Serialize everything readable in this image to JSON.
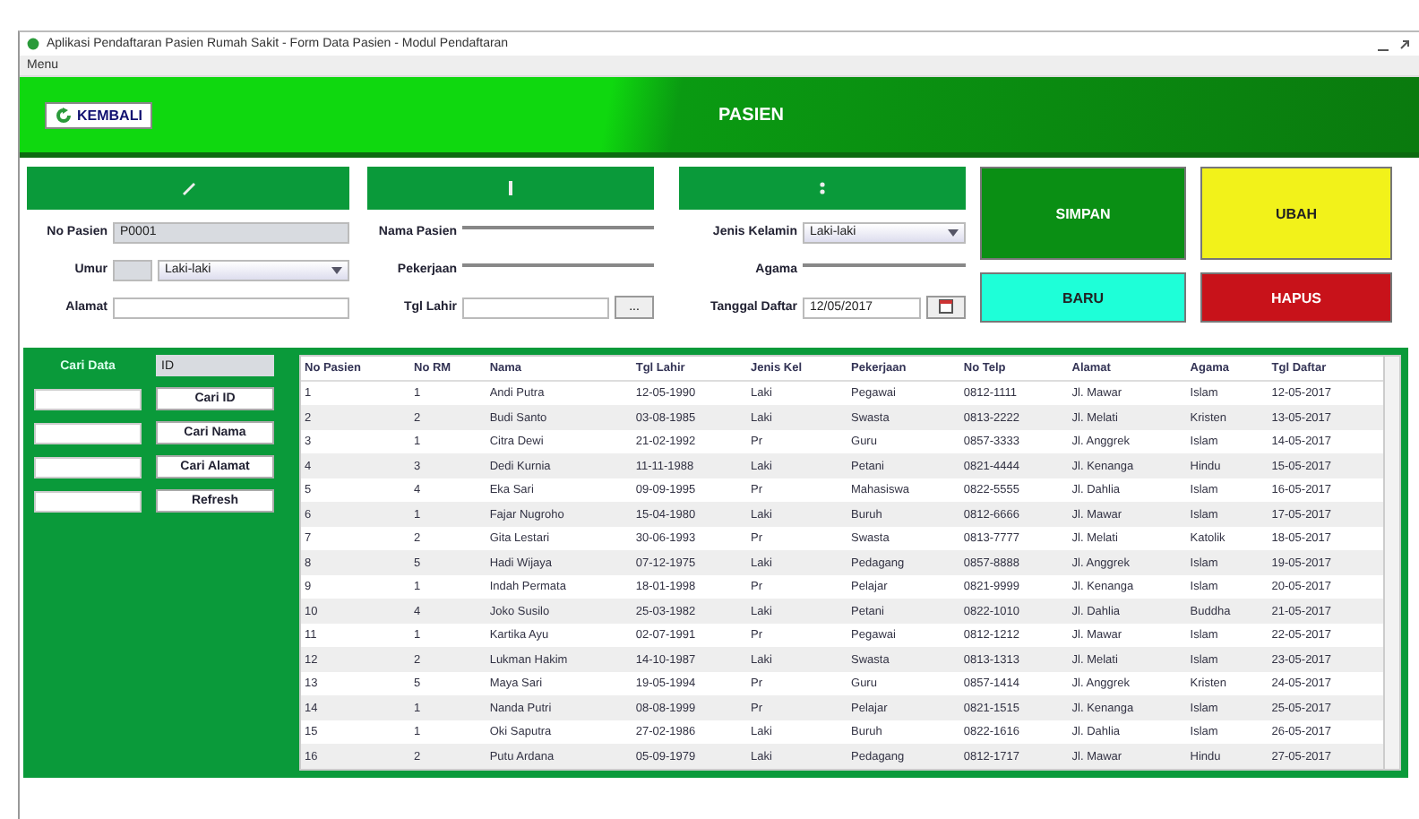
{
  "window": {
    "title": "Aplikasi Pendaftaran Pasien Rumah Sakit - Form Data Pasien - Modul Pendaftaran"
  },
  "menu": [
    "Menu"
  ],
  "header": {
    "back_button": "KEMBALI",
    "title": "PASIEN"
  },
  "sections": [
    {
      "fields": [
        {
          "kind": "readonly",
          "label": "No Pasien",
          "value": "P0001"
        },
        {
          "kind": "age-select",
          "label": "Umur",
          "value": "Laki-laki"
        },
        {
          "kind": "text",
          "label": "Alamat"
        }
      ]
    },
    {
      "fields": [
        {
          "kind": "line",
          "label": "Nama Pasien"
        },
        {
          "kind": "line",
          "label": "Pekerjaan"
        },
        {
          "kind": "picker",
          "label": "Tgl Lahir",
          "button": "..."
        }
      ]
    },
    {
      "fields": [
        {
          "kind": "select",
          "label": "Jenis Kelamin",
          "value": "Laki-laki"
        },
        {
          "kind": "line",
          "label": "Agama"
        },
        {
          "kind": "date",
          "label": "Tanggal Daftar",
          "value": "12/05/2017"
        }
      ]
    }
  ],
  "actions": [
    {
      "label": "SIMPAN",
      "color": "#0a8f14"
    },
    {
      "label": "UBAH",
      "color": "#f2f21a"
    },
    {
      "label": "BARU",
      "color": "#1effd8"
    },
    {
      "label": "HAPUS",
      "color": "#c8121a"
    }
  ],
  "search": {
    "label": "Cari Data",
    "value": "ID",
    "buttons": [
      "Cari ID",
      "Cari Nama",
      "Cari Alamat",
      "Refresh"
    ]
  },
  "table": {
    "columns": [
      "No Pasien",
      "No RM",
      "Nama",
      "Tgl Lahir",
      "Jenis Kel",
      "Pekerjaan",
      "No Telp",
      "Alamat",
      "Agama",
      "Tgl Daftar"
    ],
    "rows": [
      [
        "1",
        "1",
        "Andi Putra",
        "12-05-1990",
        "Laki",
        "Pegawai",
        "0812-1111",
        "Jl. Mawar",
        "Islam",
        "12-05-2017"
      ],
      [
        "2",
        "2",
        "Budi Santo",
        "03-08-1985",
        "Laki",
        "Swasta",
        "0813-2222",
        "Jl. Melati",
        "Kristen",
        "13-05-2017"
      ],
      [
        "3",
        "1",
        "Citra Dewi",
        "21-02-1992",
        "Pr",
        "Guru",
        "0857-3333",
        "Jl. Anggrek",
        "Islam",
        "14-05-2017"
      ],
      [
        "4",
        "3",
        "Dedi Kurnia",
        "11-11-1988",
        "Laki",
        "Petani",
        "0821-4444",
        "Jl. Kenanga",
        "Hindu",
        "15-05-2017"
      ],
      [
        "5",
        "4",
        "Eka Sari",
        "09-09-1995",
        "Pr",
        "Mahasiswa",
        "0822-5555",
        "Jl. Dahlia",
        "Islam",
        "16-05-2017"
      ],
      [
        "6",
        "1",
        "Fajar Nugroho",
        "15-04-1980",
        "Laki",
        "Buruh",
        "0812-6666",
        "Jl. Mawar",
        "Islam",
        "17-05-2017"
      ],
      [
        "7",
        "2",
        "Gita Lestari",
        "30-06-1993",
        "Pr",
        "Swasta",
        "0813-7777",
        "Jl. Melati",
        "Katolik",
        "18-05-2017"
      ],
      [
        "8",
        "5",
        "Hadi Wijaya",
        "07-12-1975",
        "Laki",
        "Pedagang",
        "0857-8888",
        "Jl. Anggrek",
        "Islam",
        "19-05-2017"
      ],
      [
        "9",
        "1",
        "Indah Permata",
        "18-01-1998",
        "Pr",
        "Pelajar",
        "0821-9999",
        "Jl. Kenanga",
        "Islam",
        "20-05-2017"
      ],
      [
        "10",
        "4",
        "Joko Susilo",
        "25-03-1982",
        "Laki",
        "Petani",
        "0822-1010",
        "Jl. Dahlia",
        "Buddha",
        "21-05-2017"
      ],
      [
        "11",
        "1",
        "Kartika Ayu",
        "02-07-1991",
        "Pr",
        "Pegawai",
        "0812-1212",
        "Jl. Mawar",
        "Islam",
        "22-05-2017"
      ],
      [
        "12",
        "2",
        "Lukman Hakim",
        "14-10-1987",
        "Laki",
        "Swasta",
        "0813-1313",
        "Jl. Melati",
        "Islam",
        "23-05-2017"
      ],
      [
        "13",
        "5",
        "Maya Sari",
        "19-05-1994",
        "Pr",
        "Guru",
        "0857-1414",
        "Jl. Anggrek",
        "Kristen",
        "24-05-2017"
      ],
      [
        "14",
        "1",
        "Nanda Putri",
        "08-08-1999",
        "Pr",
        "Pelajar",
        "0821-1515",
        "Jl. Kenanga",
        "Islam",
        "25-05-2017"
      ],
      [
        "15",
        "1",
        "Oki Saputra",
        "27-02-1986",
        "Laki",
        "Buruh",
        "0822-1616",
        "Jl. Dahlia",
        "Islam",
        "26-05-2017"
      ],
      [
        "16",
        "2",
        "Putu Ardana",
        "05-09-1979",
        "Laki",
        "Pedagang",
        "0812-1717",
        "Jl. Mawar",
        "Hindu",
        "27-05-2017"
      ]
    ]
  }
}
